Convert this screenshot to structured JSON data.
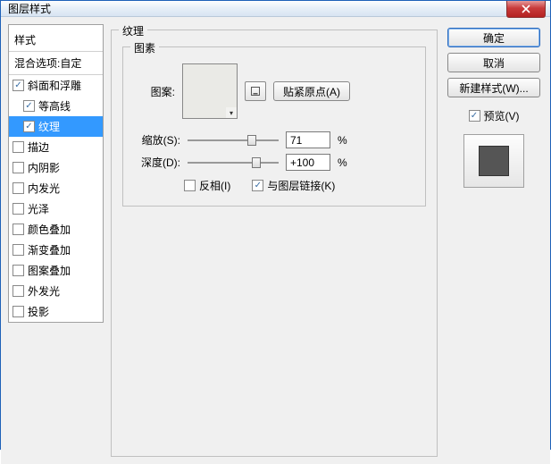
{
  "window": {
    "title": "图层样式"
  },
  "left": {
    "header": "样式",
    "subheader": "混合选项:自定",
    "items": [
      {
        "label": "斜面和浮雕",
        "checked": true,
        "child": false,
        "selected": false
      },
      {
        "label": "等高线",
        "checked": true,
        "child": true,
        "selected": false
      },
      {
        "label": "纹理",
        "checked": true,
        "child": true,
        "selected": true
      },
      {
        "label": "描边",
        "checked": false,
        "child": false,
        "selected": false
      },
      {
        "label": "内阴影",
        "checked": false,
        "child": false,
        "selected": false
      },
      {
        "label": "内发光",
        "checked": false,
        "child": false,
        "selected": false
      },
      {
        "label": "光泽",
        "checked": false,
        "child": false,
        "selected": false
      },
      {
        "label": "颜色叠加",
        "checked": false,
        "child": false,
        "selected": false
      },
      {
        "label": "渐变叠加",
        "checked": false,
        "child": false,
        "selected": false
      },
      {
        "label": "图案叠加",
        "checked": false,
        "child": false,
        "selected": false
      },
      {
        "label": "外发光",
        "checked": false,
        "child": false,
        "selected": false
      },
      {
        "label": "投影",
        "checked": false,
        "child": false,
        "selected": false
      }
    ]
  },
  "middle": {
    "outer_title": "纹理",
    "inner_title": "图素",
    "pattern_label": "图案:",
    "snap_button": "贴紧原点(A)",
    "scale_label": "缩放(S):",
    "scale_value": "71",
    "scale_unit": "%",
    "scale_pct": 71,
    "depth_label": "深度(D):",
    "depth_value": "+100",
    "depth_unit": "%",
    "depth_pct": 75,
    "invert_label": "反相(I)",
    "invert_checked": false,
    "link_label": "与图层链接(K)",
    "link_checked": true
  },
  "right": {
    "ok": "确定",
    "cancel": "取消",
    "new_style": "新建样式(W)...",
    "preview_label": "预览(V)",
    "preview_checked": true
  }
}
